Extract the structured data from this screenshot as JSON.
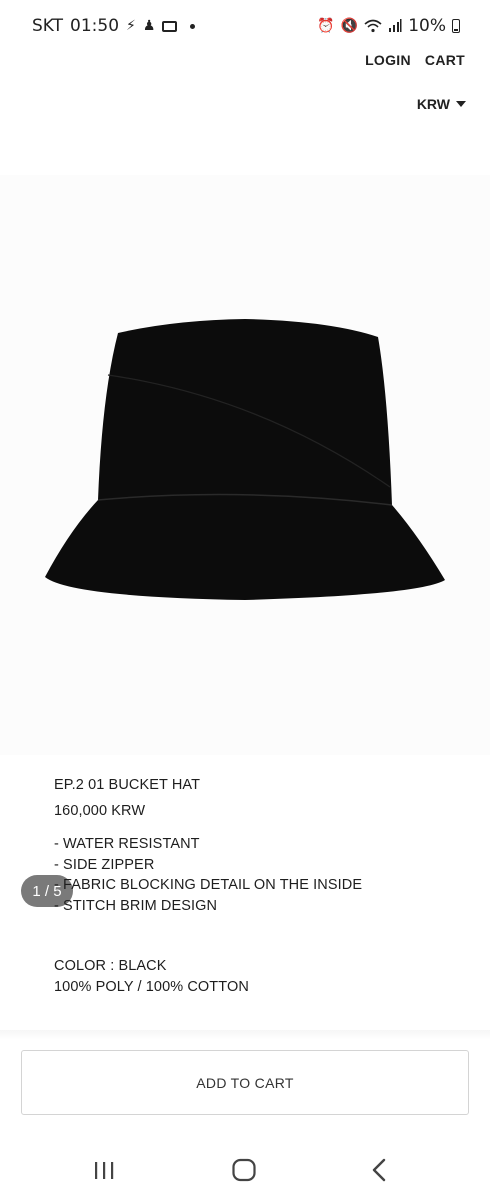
{
  "status_bar": {
    "carrier": "SKT",
    "time": "01:50",
    "battery": "10%"
  },
  "nav": {
    "login": "LOGIN",
    "cart": "CART"
  },
  "currency": {
    "selected": "KRW"
  },
  "gallery": {
    "indicator": "1 / 5",
    "current": 1,
    "total": 5
  },
  "product": {
    "name": "EP.2 01 BUCKET HAT",
    "price": "160,000 KRW",
    "features": [
      "- WATER RESISTANT",
      "- SIDE ZIPPER",
      "- FABRIC BLOCKING DETAIL ON THE INSIDE",
      "- STITCH BRIM DESIGN"
    ],
    "color": "COLOR : BLACK",
    "material": "100% POLY / 100% COTTON"
  },
  "actions": {
    "add_to_cart": "ADD TO CART"
  },
  "icons": {
    "status_left": [
      "lightning-icon",
      "notification-icon",
      "card-icon",
      "dot-icon"
    ],
    "status_right": [
      "alarm-icon",
      "mute-icon",
      "wifi-icon",
      "signal-icon",
      "battery-icon"
    ],
    "system_nav": [
      "recents-icon",
      "home-icon",
      "back-icon"
    ]
  }
}
